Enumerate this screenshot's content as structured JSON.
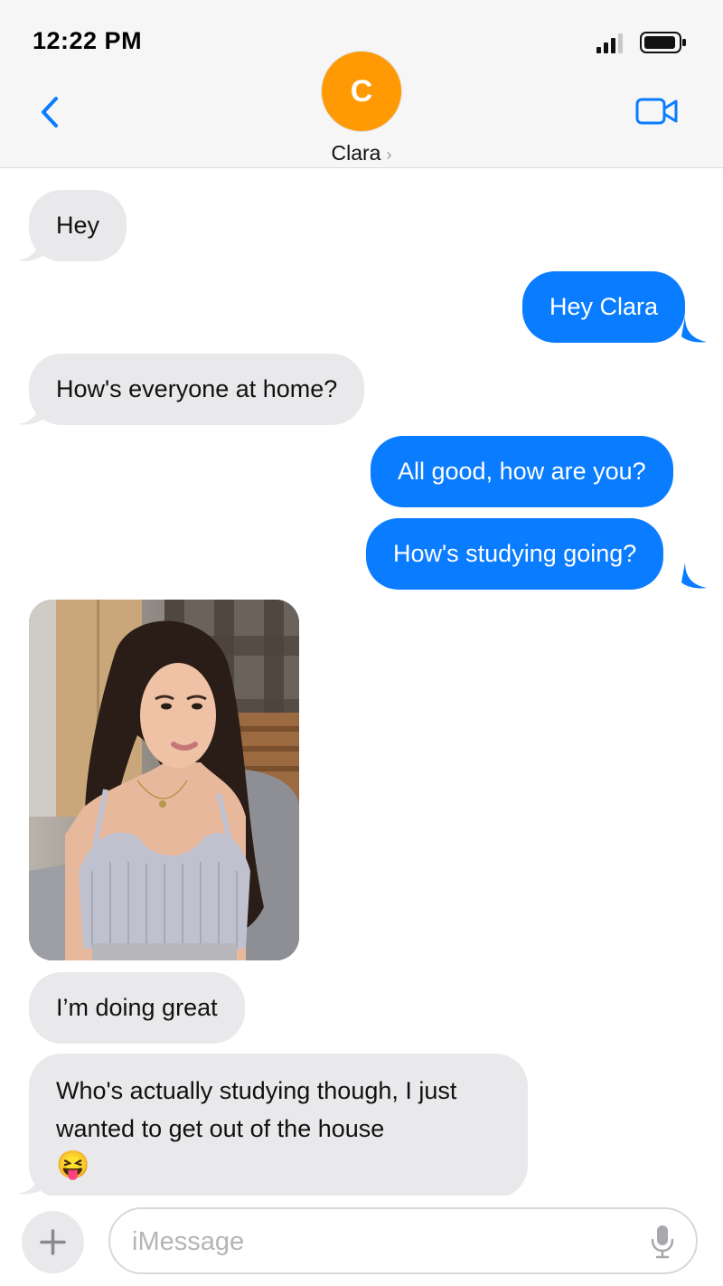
{
  "status_bar": {
    "time": "12:22 PM"
  },
  "header": {
    "avatar_initial": "C",
    "contact_name": "Clara",
    "chevron": "›",
    "back_icon": "chevron-left-icon",
    "video_icon": "video-camera-icon"
  },
  "colors": {
    "accent": "#0a7cff",
    "incoming_bubble": "#e9e9eb",
    "avatar": "#ff9a05"
  },
  "messages": [
    {
      "direction": "incoming",
      "text": "Hey"
    },
    {
      "direction": "outgoing",
      "text": "Hey Clara"
    },
    {
      "direction": "incoming",
      "text": "How's everyone at home?"
    },
    {
      "direction": "outgoing",
      "text": "All good, how are you?"
    },
    {
      "direction": "outgoing",
      "text": "How's studying going?"
    },
    {
      "direction": "incoming",
      "type": "photo",
      "description_icon": "photo-attachment"
    },
    {
      "direction": "incoming",
      "text": "I’m doing great"
    },
    {
      "direction": "incoming",
      "text": "Who's actually studying though, I just wanted to get out of the house",
      "emoji": "😝"
    }
  ],
  "input": {
    "placeholder": "iMessage",
    "value": "",
    "add_icon": "plus-icon",
    "mic_icon": "microphone-icon"
  }
}
